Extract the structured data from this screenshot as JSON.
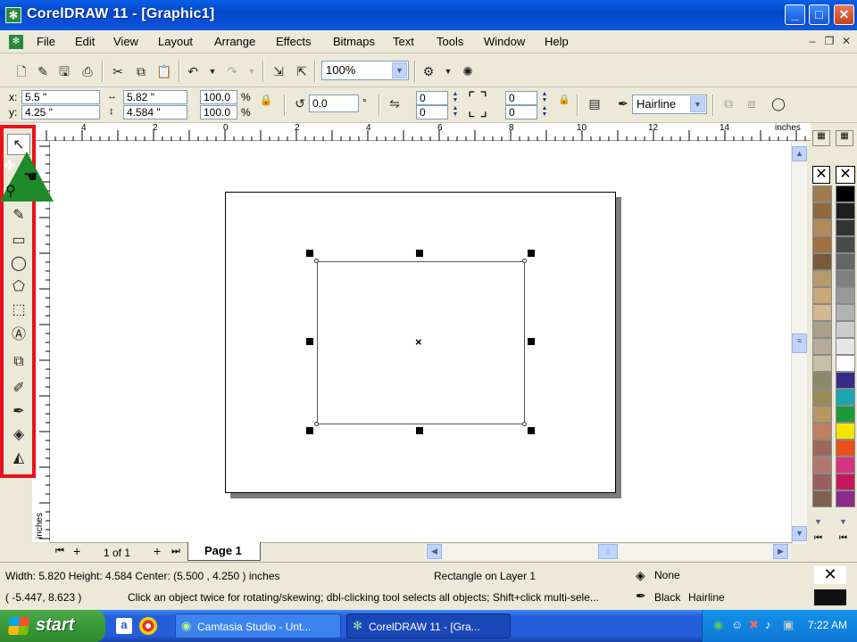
{
  "window": {
    "title": "CorelDRAW 11 - [Graphic1]",
    "app_icon": "coreldraw-icon",
    "min": "_",
    "max": "□",
    "close": "✕"
  },
  "menu": [
    "File",
    "Edit",
    "View",
    "Layout",
    "Arrange",
    "Effects",
    "Bitmaps",
    "Text",
    "Tools",
    "Window",
    "Help"
  ],
  "standard_toolbar": {
    "zoom_value": "100%"
  },
  "property_bar": {
    "x_label": "x:",
    "x_value": "5.5 \"",
    "y_label": "y:",
    "y_value": "4.25 \"",
    "width_value": "5.82 \"",
    "height_value": "4.584 \"",
    "scale_w": "100.0",
    "scale_h": "100.0",
    "percent": "%",
    "rotation": "0.0",
    "degree": "°",
    "corner_tl": "0",
    "corner_bl": "0",
    "corner_tr": "0",
    "corner_br": "0",
    "outline_width": "Hairline"
  },
  "ruler": {
    "h_ticks": [
      "4",
      "2",
      "0",
      "2",
      "4",
      "6",
      "8",
      "10",
      "12",
      "14"
    ],
    "h_unit": "inches",
    "v_unit": "inches"
  },
  "page_nav": {
    "counter": "1 of 1",
    "tab": "Page 1"
  },
  "palette": {
    "colors": [
      "#000000",
      "#1e1e1e",
      "#333333",
      "#4a4a4a",
      "#666666",
      "#808080",
      "#999999",
      "#b3b3b3",
      "#cccccc",
      "#e6e6e6",
      "#ffffff",
      "#3a2a88",
      "#1aa6b0",
      "#1e9a3c",
      "#f2e600",
      "#e8501c",
      "#d63384",
      "#c2185b",
      "#8b2a8a"
    ],
    "tan_colors": [
      "#9e7b4f",
      "#8f6a3e",
      "#b08a5a",
      "#a07040",
      "#7a5a3a",
      "#b59b6a",
      "#c8a878",
      "#d4b894",
      "#a9a08a",
      "#b6ab98",
      "#c9bfa8",
      "#8a8a6a",
      "#9a8a5a",
      "#b89860",
      "#c08060",
      "#a06858",
      "#b0786a",
      "#986060",
      "#806050"
    ]
  },
  "status": {
    "dimensions": "Width: 5.820  Height: 4.584  Center: (5.500 , 4.250 ) inches",
    "object_info": "Rectangle on Layer 1",
    "fill_label": "None",
    "coordinates": "( -5.447, 8.623 )",
    "hint": "Click an object twice for rotating/skewing; dbl-clicking tool selects all objects; Shift+click multi-sele...",
    "outline_color": "Black",
    "outline_width": "Hairline"
  },
  "taskbar": {
    "start": "start",
    "tasks": [
      {
        "label": "Camtasia Studio - Unt...",
        "icon": "camtasia-icon"
      },
      {
        "label": "CorelDRAW 11 - [Gra...",
        "icon": "coreldraw-icon"
      }
    ],
    "clock": "7:22 AM"
  }
}
